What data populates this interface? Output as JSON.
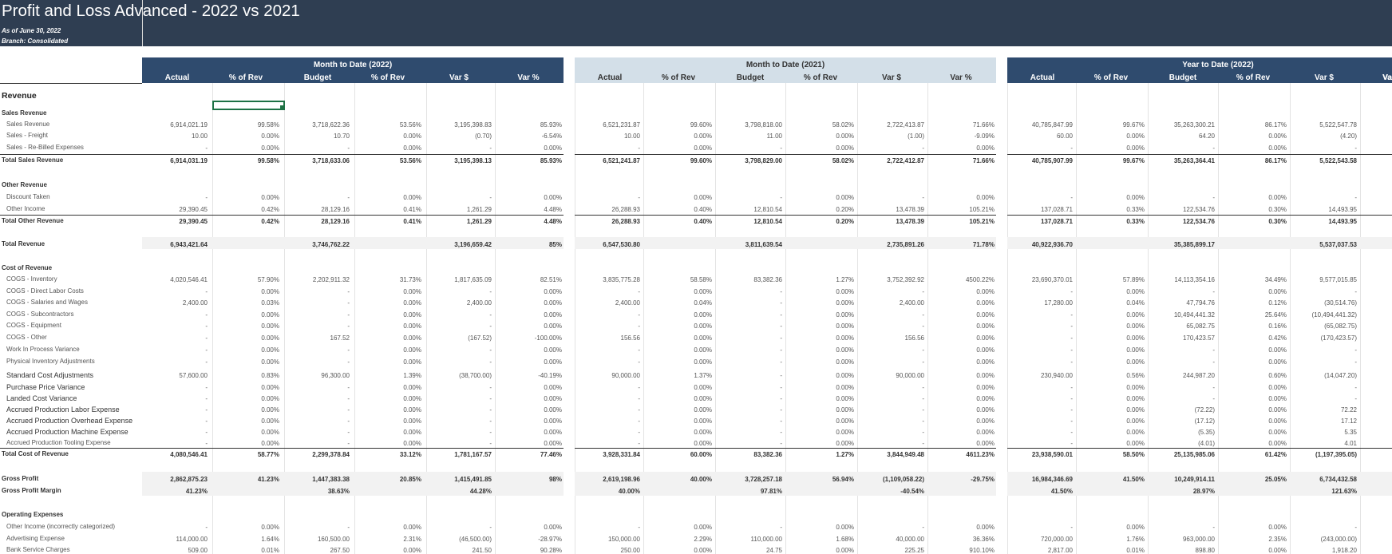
{
  "report": {
    "title": "Profit and Loss Advanced - 2022 vs 2021",
    "as_of": "As of June 30, 2022",
    "branch": "Branch: Consolidated"
  },
  "columns": [
    "Actual",
    "% of Rev",
    "Budget",
    "% of Rev",
    "Var $",
    "Var %"
  ],
  "sections": [
    {
      "title": "Month to Date (2022)",
      "style": "dark"
    },
    {
      "title": "Month to Date (2021)",
      "style": "light"
    },
    {
      "title": "Year to Date (2022)",
      "style": "dark"
    }
  ],
  "truncated_col_label": "Va",
  "rows": [
    {
      "label": "Revenue",
      "type": "h1",
      "vals": []
    },
    {
      "label": "Sales Revenue",
      "type": "h2",
      "vals": []
    },
    {
      "label": "Sales Revenue",
      "type": "item",
      "vals": [
        "6,914,021.19",
        "99.58%",
        "3,718,622.36",
        "53.56%",
        "3,195,398.83",
        "85.93%",
        "6,521,231.87",
        "99.60%",
        "3,798,818.00",
        "58.02%",
        "2,722,413.87",
        "71.66%",
        "40,785,847.99",
        "99.67%",
        "35,263,300.21",
        "86.17%",
        "5,522,547.78"
      ]
    },
    {
      "label": "Sales - Freight",
      "type": "item",
      "vals": [
        "10.00",
        "0.00%",
        "10.70",
        "0.00%",
        "(0.70)",
        "-6.54%",
        "10.00",
        "0.00%",
        "11.00",
        "0.00%",
        "(1.00)",
        "-9.09%",
        "60.00",
        "0.00%",
        "64.20",
        "0.00%",
        "(4.20)"
      ]
    },
    {
      "label": "Sales - Re-Billed Expenses",
      "type": "item",
      "vals": [
        "-",
        "0.00%",
        "-",
        "0.00%",
        "-",
        "0.00%",
        "-",
        "0.00%",
        "-",
        "0.00%",
        "-",
        "0.00%",
        "-",
        "0.00%",
        "-",
        "0.00%",
        "-"
      ]
    },
    {
      "label": "Total Sales Revenue",
      "type": "total",
      "vals": [
        "6,914,031.19",
        "99.58%",
        "3,718,633.06",
        "53.56%",
        "3,195,398.13",
        "85.93%",
        "6,521,241.87",
        "99.60%",
        "3,798,829.00",
        "58.02%",
        "2,722,412.87",
        "71.66%",
        "40,785,907.99",
        "99.67%",
        "35,263,364.41",
        "86.17%",
        "5,522,543.58"
      ]
    },
    {
      "label": "",
      "type": "blank",
      "vals": []
    },
    {
      "label": "Other Revenue",
      "type": "h2",
      "vals": []
    },
    {
      "label": "Discount Taken",
      "type": "item",
      "vals": [
        "-",
        "0.00%",
        "-",
        "0.00%",
        "-",
        "0.00%",
        "-",
        "0.00%",
        "-",
        "0.00%",
        "-",
        "0.00%",
        "-",
        "0.00%",
        "-",
        "0.00%",
        "-"
      ]
    },
    {
      "label": "Other Income",
      "type": "item",
      "vals": [
        "29,390.45",
        "0.42%",
        "28,129.16",
        "0.41%",
        "1,261.29",
        "4.48%",
        "26,288.93",
        "0.40%",
        "12,810.54",
        "0.20%",
        "13,478.39",
        "105.21%",
        "137,028.71",
        "0.33%",
        "122,534.76",
        "0.30%",
        "14,493.95"
      ]
    },
    {
      "label": "Total Other Revenue",
      "type": "total",
      "vals": [
        "29,390.45",
        "0.42%",
        "28,129.16",
        "0.41%",
        "1,261.29",
        "4.48%",
        "26,288.93",
        "0.40%",
        "12,810.54",
        "0.20%",
        "13,478.39",
        "105.21%",
        "137,028.71",
        "0.33%",
        "122,534.76",
        "0.30%",
        "14,493.95"
      ]
    },
    {
      "label": "",
      "type": "blank",
      "vals": []
    },
    {
      "label": "Total Revenue",
      "type": "grand",
      "vals": [
        "6,943,421.64",
        "",
        "3,746,762.22",
        "",
        "3,196,659.42",
        "85%",
        "6,547,530.80",
        "",
        "3,811,639.54",
        "",
        "2,735,891.26",
        "71.78%",
        "40,922,936.70",
        "",
        "35,385,899.17",
        "",
        "5,537,037.53"
      ]
    },
    {
      "label": "",
      "type": "blank",
      "vals": []
    },
    {
      "label": "Cost of Revenue",
      "type": "h2",
      "vals": []
    },
    {
      "label": "COGS - Inventory",
      "type": "item",
      "vals": [
        "4,020,546.41",
        "57.90%",
        "2,202,911.32",
        "31.73%",
        "1,817,635.09",
        "82.51%",
        "3,835,775.28",
        "58.58%",
        "83,382.36",
        "1.27%",
        "3,752,392.92",
        "4500.22%",
        "23,690,370.01",
        "57.89%",
        "14,113,354.16",
        "34.49%",
        "9,577,015.85"
      ]
    },
    {
      "label": "COGS - Direct Labor Costs",
      "type": "item",
      "vals": [
        "-",
        "0.00%",
        "-",
        "0.00%",
        "-",
        "0.00%",
        "-",
        "0.00%",
        "-",
        "0.00%",
        "-",
        "0.00%",
        "-",
        "0.00%",
        "-",
        "0.00%",
        "-"
      ]
    },
    {
      "label": "COGS - Salaries and Wages",
      "type": "item",
      "vals": [
        "2,400.00",
        "0.03%",
        "-",
        "0.00%",
        "2,400.00",
        "0.00%",
        "2,400.00",
        "0.04%",
        "-",
        "0.00%",
        "2,400.00",
        "0.00%",
        "17,280.00",
        "0.04%",
        "47,794.76",
        "0.12%",
        "(30,514.76)"
      ]
    },
    {
      "label": "COGS - Subcontractors",
      "type": "item",
      "vals": [
        "-",
        "0.00%",
        "-",
        "0.00%",
        "-",
        "0.00%",
        "-",
        "0.00%",
        "-",
        "0.00%",
        "-",
        "0.00%",
        "-",
        "0.00%",
        "10,494,441.32",
        "25.64%",
        "(10,494,441.32)"
      ]
    },
    {
      "label": "COGS - Equipment",
      "type": "item",
      "vals": [
        "-",
        "0.00%",
        "-",
        "0.00%",
        "-",
        "0.00%",
        "-",
        "0.00%",
        "-",
        "0.00%",
        "-",
        "0.00%",
        "-",
        "0.00%",
        "65,082.75",
        "0.16%",
        "(65,082.75)"
      ]
    },
    {
      "label": "COGS - Other",
      "type": "item",
      "vals": [
        "-",
        "0.00%",
        "167.52",
        "0.00%",
        "(167.52)",
        "-100.00%",
        "156.56",
        "0.00%",
        "-",
        "0.00%",
        "156.56",
        "0.00%",
        "-",
        "0.00%",
        "170,423.57",
        "0.42%",
        "(170,423.57)"
      ]
    },
    {
      "label": "Work In Process Variance",
      "type": "item",
      "vals": [
        "-",
        "0.00%",
        "-",
        "0.00%",
        "-",
        "0.00%",
        "-",
        "0.00%",
        "-",
        "0.00%",
        "-",
        "0.00%",
        "-",
        "0.00%",
        "-",
        "0.00%",
        "-"
      ]
    },
    {
      "label": "Physical Inventory Adjustments",
      "type": "item",
      "vals": [
        "-",
        "0.00%",
        "-",
        "0.00%",
        "-",
        "0.00%",
        "-",
        "0.00%",
        "-",
        "0.00%",
        "-",
        "0.00%",
        "-",
        "0.00%",
        "-",
        "0.00%",
        "-"
      ]
    },
    {
      "label": "Standard Cost Adjustments",
      "type": "item-lg",
      "vals": [
        "57,600.00",
        "0.83%",
        "96,300.00",
        "1.39%",
        "(38,700.00)",
        "-40.19%",
        "90,000.00",
        "1.37%",
        "-",
        "0.00%",
        "90,000.00",
        "0.00%",
        "230,940.00",
        "0.56%",
        "244,987.20",
        "0.60%",
        "(14,047.20)"
      ]
    },
    {
      "label": "Purchase Price Variance",
      "type": "item-lg",
      "vals": [
        "-",
        "0.00%",
        "-",
        "0.00%",
        "-",
        "0.00%",
        "-",
        "0.00%",
        "-",
        "0.00%",
        "-",
        "0.00%",
        "-",
        "0.00%",
        "-",
        "0.00%",
        "-"
      ]
    },
    {
      "label": "Landed Cost Variance",
      "type": "item-lg",
      "vals": [
        "-",
        "0.00%",
        "-",
        "0.00%",
        "-",
        "0.00%",
        "-",
        "0.00%",
        "-",
        "0.00%",
        "-",
        "0.00%",
        "-",
        "0.00%",
        "-",
        "0.00%",
        "-"
      ]
    },
    {
      "label": "Accrued Production Labor Expense",
      "type": "item-lg",
      "vals": [
        "-",
        "0.00%",
        "-",
        "0.00%",
        "-",
        "0.00%",
        "-",
        "0.00%",
        "-",
        "0.00%",
        "-",
        "0.00%",
        "-",
        "0.00%",
        "(72.22)",
        "0.00%",
        "72.22"
      ]
    },
    {
      "label": "Accrued Production Overhead Expense",
      "type": "item-lg",
      "vals": [
        "-",
        "0.00%",
        "-",
        "0.00%",
        "-",
        "0.00%",
        "-",
        "0.00%",
        "-",
        "0.00%",
        "-",
        "0.00%",
        "-",
        "0.00%",
        "(17.12)",
        "0.00%",
        "17.12"
      ]
    },
    {
      "label": "Accrued Production Machine Expense",
      "type": "item-lg",
      "vals": [
        "-",
        "0.00%",
        "-",
        "0.00%",
        "-",
        "0.00%",
        "-",
        "0.00%",
        "-",
        "0.00%",
        "-",
        "0.00%",
        "-",
        "0.00%",
        "(5.35)",
        "0.00%",
        "5.35"
      ]
    },
    {
      "label": "Accrued Production Tooling Expense",
      "type": "item",
      "vals": [
        "-",
        "0.00%",
        "-",
        "0.00%",
        "-",
        "0.00%",
        "-",
        "0.00%",
        "-",
        "0.00%",
        "-",
        "0.00%",
        "-",
        "0.00%",
        "(4.01)",
        "0.00%",
        "4.01"
      ]
    },
    {
      "label": "Total Cost of Revenue",
      "type": "total",
      "vals": [
        "4,080,546.41",
        "58.77%",
        "2,299,378.84",
        "33.12%",
        "1,781,167.57",
        "77.46%",
        "3,928,331.84",
        "60.00%",
        "83,382.36",
        "1.27%",
        "3,844,949.48",
        "4611.23%",
        "23,938,590.01",
        "58.50%",
        "25,135,985.06",
        "61.42%",
        "(1,197,395.05)"
      ]
    },
    {
      "label": "",
      "type": "blank",
      "vals": []
    },
    {
      "label": "Gross Profit",
      "type": "grand",
      "vals": [
        "2,862,875.23",
        "41.23%",
        "1,447,383.38",
        "20.85%",
        "1,415,491.85",
        "98%",
        "2,619,198.96",
        "40.00%",
        "3,728,257.18",
        "56.94%",
        "(1,109,058.22)",
        "-29.75%",
        "16,984,346.69",
        "41.50%",
        "10,249,914.11",
        "25.05%",
        "6,734,432.58"
      ]
    },
    {
      "label": "Gross Profit Margin",
      "type": "grand",
      "vals": [
        "41.23%",
        "",
        "38.63%",
        "",
        "44.28%",
        "",
        "40.00%",
        "",
        "97.81%",
        "",
        "-40.54%",
        "",
        "41.50%",
        "",
        "28.97%",
        "",
        "121.63%"
      ]
    },
    {
      "label": "",
      "type": "blank",
      "vals": []
    },
    {
      "label": "Operating Expenses",
      "type": "h2",
      "vals": []
    },
    {
      "label": "Other Income (incorrectly categorized)",
      "type": "item",
      "vals": [
        "-",
        "0.00%",
        "-",
        "0.00%",
        "-",
        "0.00%",
        "-",
        "0.00%",
        "-",
        "0.00%",
        "-",
        "0.00%",
        "-",
        "0.00%",
        "-",
        "0.00%",
        "-"
      ]
    },
    {
      "label": "Advertising Expense",
      "type": "item",
      "vals": [
        "114,000.00",
        "1.64%",
        "160,500.00",
        "2.31%",
        "(46,500.00)",
        "-28.97%",
        "150,000.00",
        "2.29%",
        "110,000.00",
        "1.68%",
        "40,000.00",
        "36.36%",
        "720,000.00",
        "1.76%",
        "963,000.00",
        "2.35%",
        "(243,000.00)"
      ]
    },
    {
      "label": "Bank Service Charges",
      "type": "item",
      "vals": [
        "509.00",
        "0.01%",
        "267.50",
        "0.00%",
        "241.50",
        "90.28%",
        "250.00",
        "0.00%",
        "24.75",
        "0.00%",
        "225.25",
        "910.10%",
        "2,817.00",
        "0.01%",
        "898.80",
        "0.00%",
        "1,918.20"
      ]
    }
  ]
}
